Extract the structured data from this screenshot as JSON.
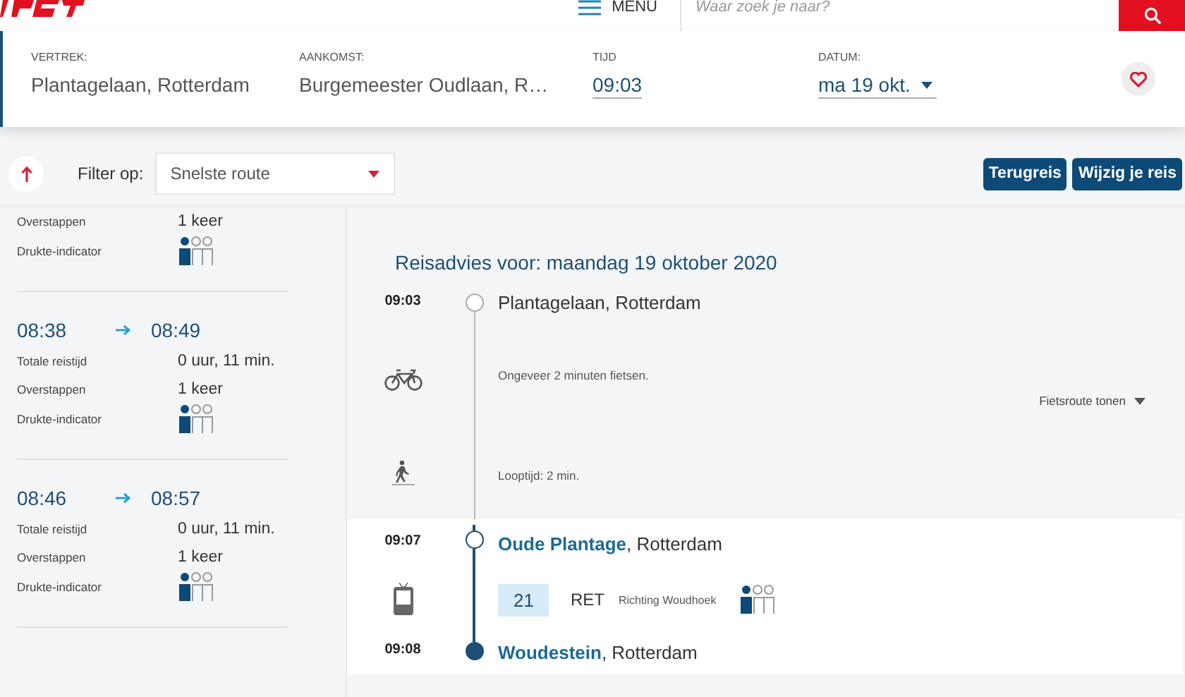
{
  "header": {
    "menu_label": "MENU",
    "search": {
      "placeholder": "Waar zoek je naar?"
    }
  },
  "trip": {
    "fields": [
      {
        "label": "VERTREK:",
        "value": "Plantagelaan, Rotterdam",
        "kind": "text"
      },
      {
        "label": "AANKOMST:",
        "value": "Burgemeester Oudlaan, R…",
        "kind": "text"
      },
      {
        "label": "TIJD",
        "value": "09:03",
        "kind": "time"
      },
      {
        "label": "DATUM:",
        "value": "ma 19 okt.",
        "kind": "select"
      }
    ]
  },
  "filter": {
    "label": "Filter op:",
    "value": "Snelste route"
  },
  "buttons": [
    "Terugreis",
    "Wijzig je reis"
  ],
  "journeys": [
    {
      "rows": [
        {
          "label": "Overstappen",
          "value": "1 keer",
          "kind": "text"
        },
        {
          "label": "Drukte-indicator",
          "kind": "crowd"
        }
      ]
    },
    {
      "depart": "08:38",
      "arrive": "08:49",
      "rows": [
        {
          "label": "Totale reistijd",
          "value": "0 uur, 11 min.",
          "kind": "text"
        },
        {
          "label": "Overstappen",
          "value": "1 keer",
          "kind": "text"
        },
        {
          "label": "Drukte-indicator",
          "kind": "crowd"
        }
      ]
    },
    {
      "depart": "08:46",
      "arrive": "08:57",
      "rows": [
        {
          "label": "Totale reistijd",
          "value": "0 uur, 11 min.",
          "kind": "text"
        },
        {
          "label": "Overstappen",
          "value": "1 keer",
          "kind": "text"
        },
        {
          "label": "Drukte-indicator",
          "kind": "crowd"
        }
      ]
    }
  ],
  "advice": {
    "title": "Reisadvies voor: maandag 19 oktober 2020",
    "sections": [
      {
        "highlighted": false,
        "steps": [
          {
            "kind": "stop",
            "time": "09:03",
            "name": "Plantagelaan, Rotterdam",
            "filled": false
          },
          {
            "kind": "bike",
            "text": "Ongeveer 2 minuten fietsen.",
            "toggle": "Fietsroute tonen"
          },
          {
            "kind": "walk",
            "text": "Looptijd: 2 min."
          }
        ]
      },
      {
        "highlighted": true,
        "steps": [
          {
            "kind": "stop",
            "time": "09:07",
            "link": "Oude Plantage",
            "rest": ", Rotterdam",
            "filled": false
          },
          {
            "kind": "transit",
            "line": "21",
            "operator": "RET",
            "direction": "Richting Woudhoek"
          },
          {
            "kind": "stop",
            "time": "09:08",
            "link": "Woudestein",
            "rest": ", Rotterdam",
            "filled": true
          }
        ]
      }
    ]
  }
}
